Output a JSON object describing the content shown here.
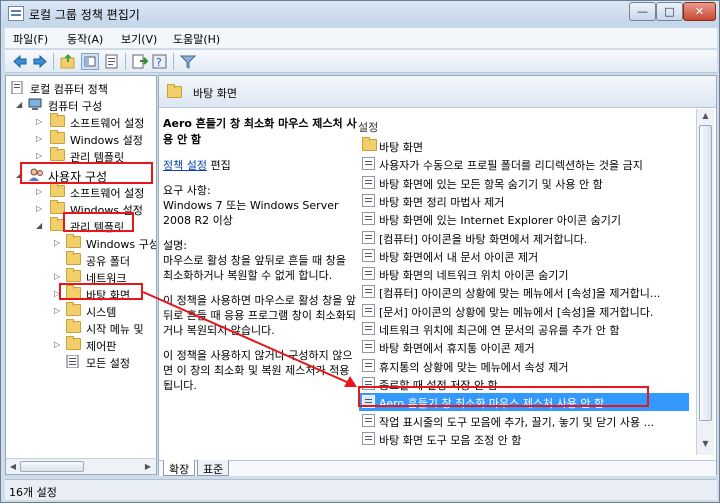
{
  "window": {
    "title": "로컬 그룹 정책 편집기",
    "min": "—",
    "max": "□",
    "close": "✕"
  },
  "menu": [
    "파일(F)",
    "동작(A)",
    "보기(V)",
    "도움말(H)"
  ],
  "tree": {
    "root": "로컬 컴퓨터 정책",
    "computer": "컴퓨터 구성",
    "computer_children": [
      "소프트웨어 설정",
      "Windows 설정",
      "관리 템플릿"
    ],
    "user": "사용자 구성",
    "user_children": [
      "소프트웨어 설정",
      "Windows 설정"
    ],
    "admin": "관리 템플릿",
    "admin_children": [
      "Windows 구성",
      "공유 폴더",
      "네트워크",
      "바탕 화면",
      "시스템",
      "시작 메뉴 및",
      "제어판",
      "모든 설정"
    ]
  },
  "right": {
    "header": "바탕 화면",
    "desc": {
      "title": "Aero 흔들기 창 최소화 마우스 제스처 사용 안 함",
      "edit_link": "정책 설정",
      "edit_suffix": " 편집",
      "req_label": "요구 사항:",
      "req_text": "Windows 7 또는 Windows Server 2008 R2 이상",
      "desc_label": "설명:",
      "desc_text": "마우스로 활성 창을 앞뒤로 흔들 때 창을 최소화하거나 복원할 수 없게 합니다.",
      "p2": "이 정책을 사용하면 마우스로 활성 창을 앞뒤로 흔들 때 응용 프로그램 창이 최소화되거나 복원되지 않습니다.",
      "p3": "이 정책을 사용하지 않거나 구성하지 않으면 이 창의 최소화 및 복원 제스처가 적용됩니다."
    },
    "list_header": "설정",
    "items": [
      "바탕 화면",
      "사용자가 수동으로 프로필 폴더를 리디렉션하는 것을 금지",
      "바탕 화면에 있는 모든 항목 숨기기 및 사용 안 함",
      "바탕 화면 정리 마법사 제거",
      "바탕 화면에 있는 Internet Explorer 아이콘 숨기기",
      "[컴퓨터] 아이콘을 바탕 화면에서 제거합니다.",
      "바탕 화면에서 내 문서 아이콘 제거",
      "바탕 화면의 네트워크 위치 아이콘 숨기기",
      "[컴퓨터] 아이콘의 상황에 맞는 메뉴에서 [속성]을 제거합니...",
      "[문서] 아이콘의 상황에 맞는 메뉴에서 [속성]을 제거합니다.",
      "네트워크 위치에 최근에 연 문서의 공유를 추가 안 함",
      "바탕 화면에서 휴지통 아이콘 제거",
      "휴지통의 상황에 맞는 메뉴에서 속성 제거",
      "종료할 때 설정 저장 안 함",
      "Aero 흔들기 창 최소화 마우스 제스처 사용 안 함",
      "작업 표시줄의 도구 모음에 추가, 끌기, 놓기 및 닫기 사용 ...",
      "바탕 화면 도구 모음 조정 안 함"
    ],
    "tabs": [
      "확장",
      "표준"
    ]
  },
  "status": "16개 설정",
  "colors": {
    "highlight": "#e8161b",
    "selection": "#3399ff",
    "link": "#0645ad"
  }
}
